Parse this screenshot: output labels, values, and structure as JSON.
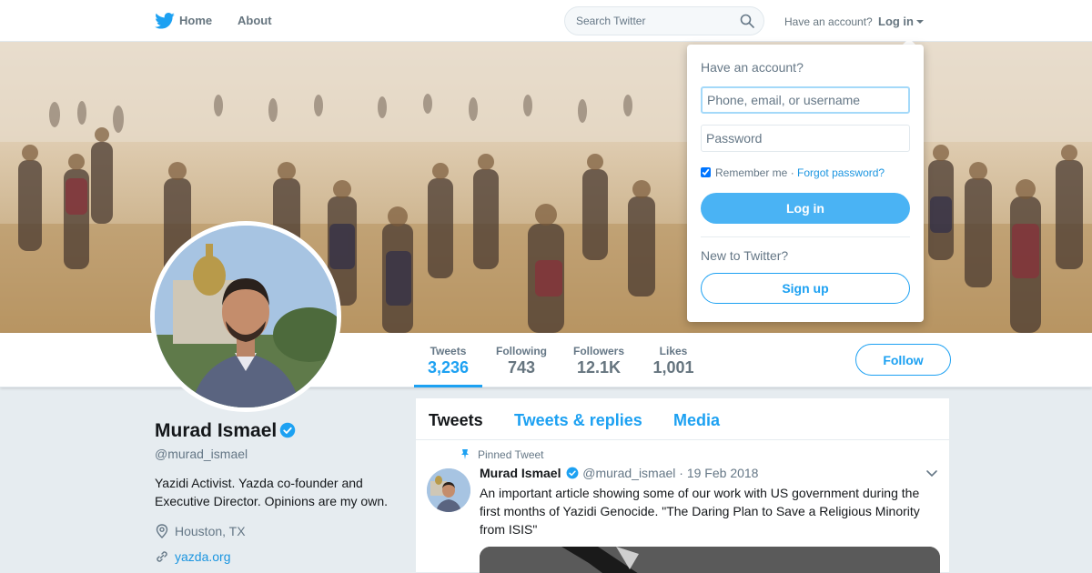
{
  "nav": {
    "home": "Home",
    "about": "About",
    "search_placeholder": "Search Twitter",
    "have_account": "Have an account?",
    "login": "Log in"
  },
  "profile": {
    "name": "Murad Ismael",
    "handle": "@murad_ismael",
    "bio": "Yazidi Activist. Yazda co-founder and Executive Director. Opinions are my own.",
    "location": "Houston, TX",
    "url": "yazda.org",
    "verified": true
  },
  "stats": [
    {
      "label": "Tweets",
      "value": "3,236"
    },
    {
      "label": "Following",
      "value": "743"
    },
    {
      "label": "Followers",
      "value": "12.1K"
    },
    {
      "label": "Likes",
      "value": "1,001"
    }
  ],
  "follow_label": "Follow",
  "tabs": [
    "Tweets",
    "Tweets & replies",
    "Media"
  ],
  "tweet": {
    "pinned_label": "Pinned Tweet",
    "author": "Murad Ismael",
    "handle": "@murad_ismael",
    "date": "· 19 Feb 2018",
    "text": "An important article showing some of our work with US government during the first months of Yazidi Genocide.  \"The Daring Plan to Save a Religious Minority from ISIS\""
  },
  "login_dropdown": {
    "title": "Have an account?",
    "username_placeholder": "Phone, email, or username",
    "password_placeholder": "Password",
    "remember": "Remember me",
    "separator": "·",
    "forgot": "Forgot password?",
    "login_button": "Log in",
    "new_to_twitter": "New to Twitter?",
    "signup_button": "Sign up"
  },
  "colors": {
    "brand": "#1da1f2",
    "login_button": "#4ab3f4",
    "background": "#e6ecf0"
  },
  "icons": [
    "twitter-bird-icon",
    "search-icon",
    "caret-down-icon",
    "verified-icon",
    "location-icon",
    "link-icon",
    "pin-icon",
    "chevron-down-icon"
  ]
}
